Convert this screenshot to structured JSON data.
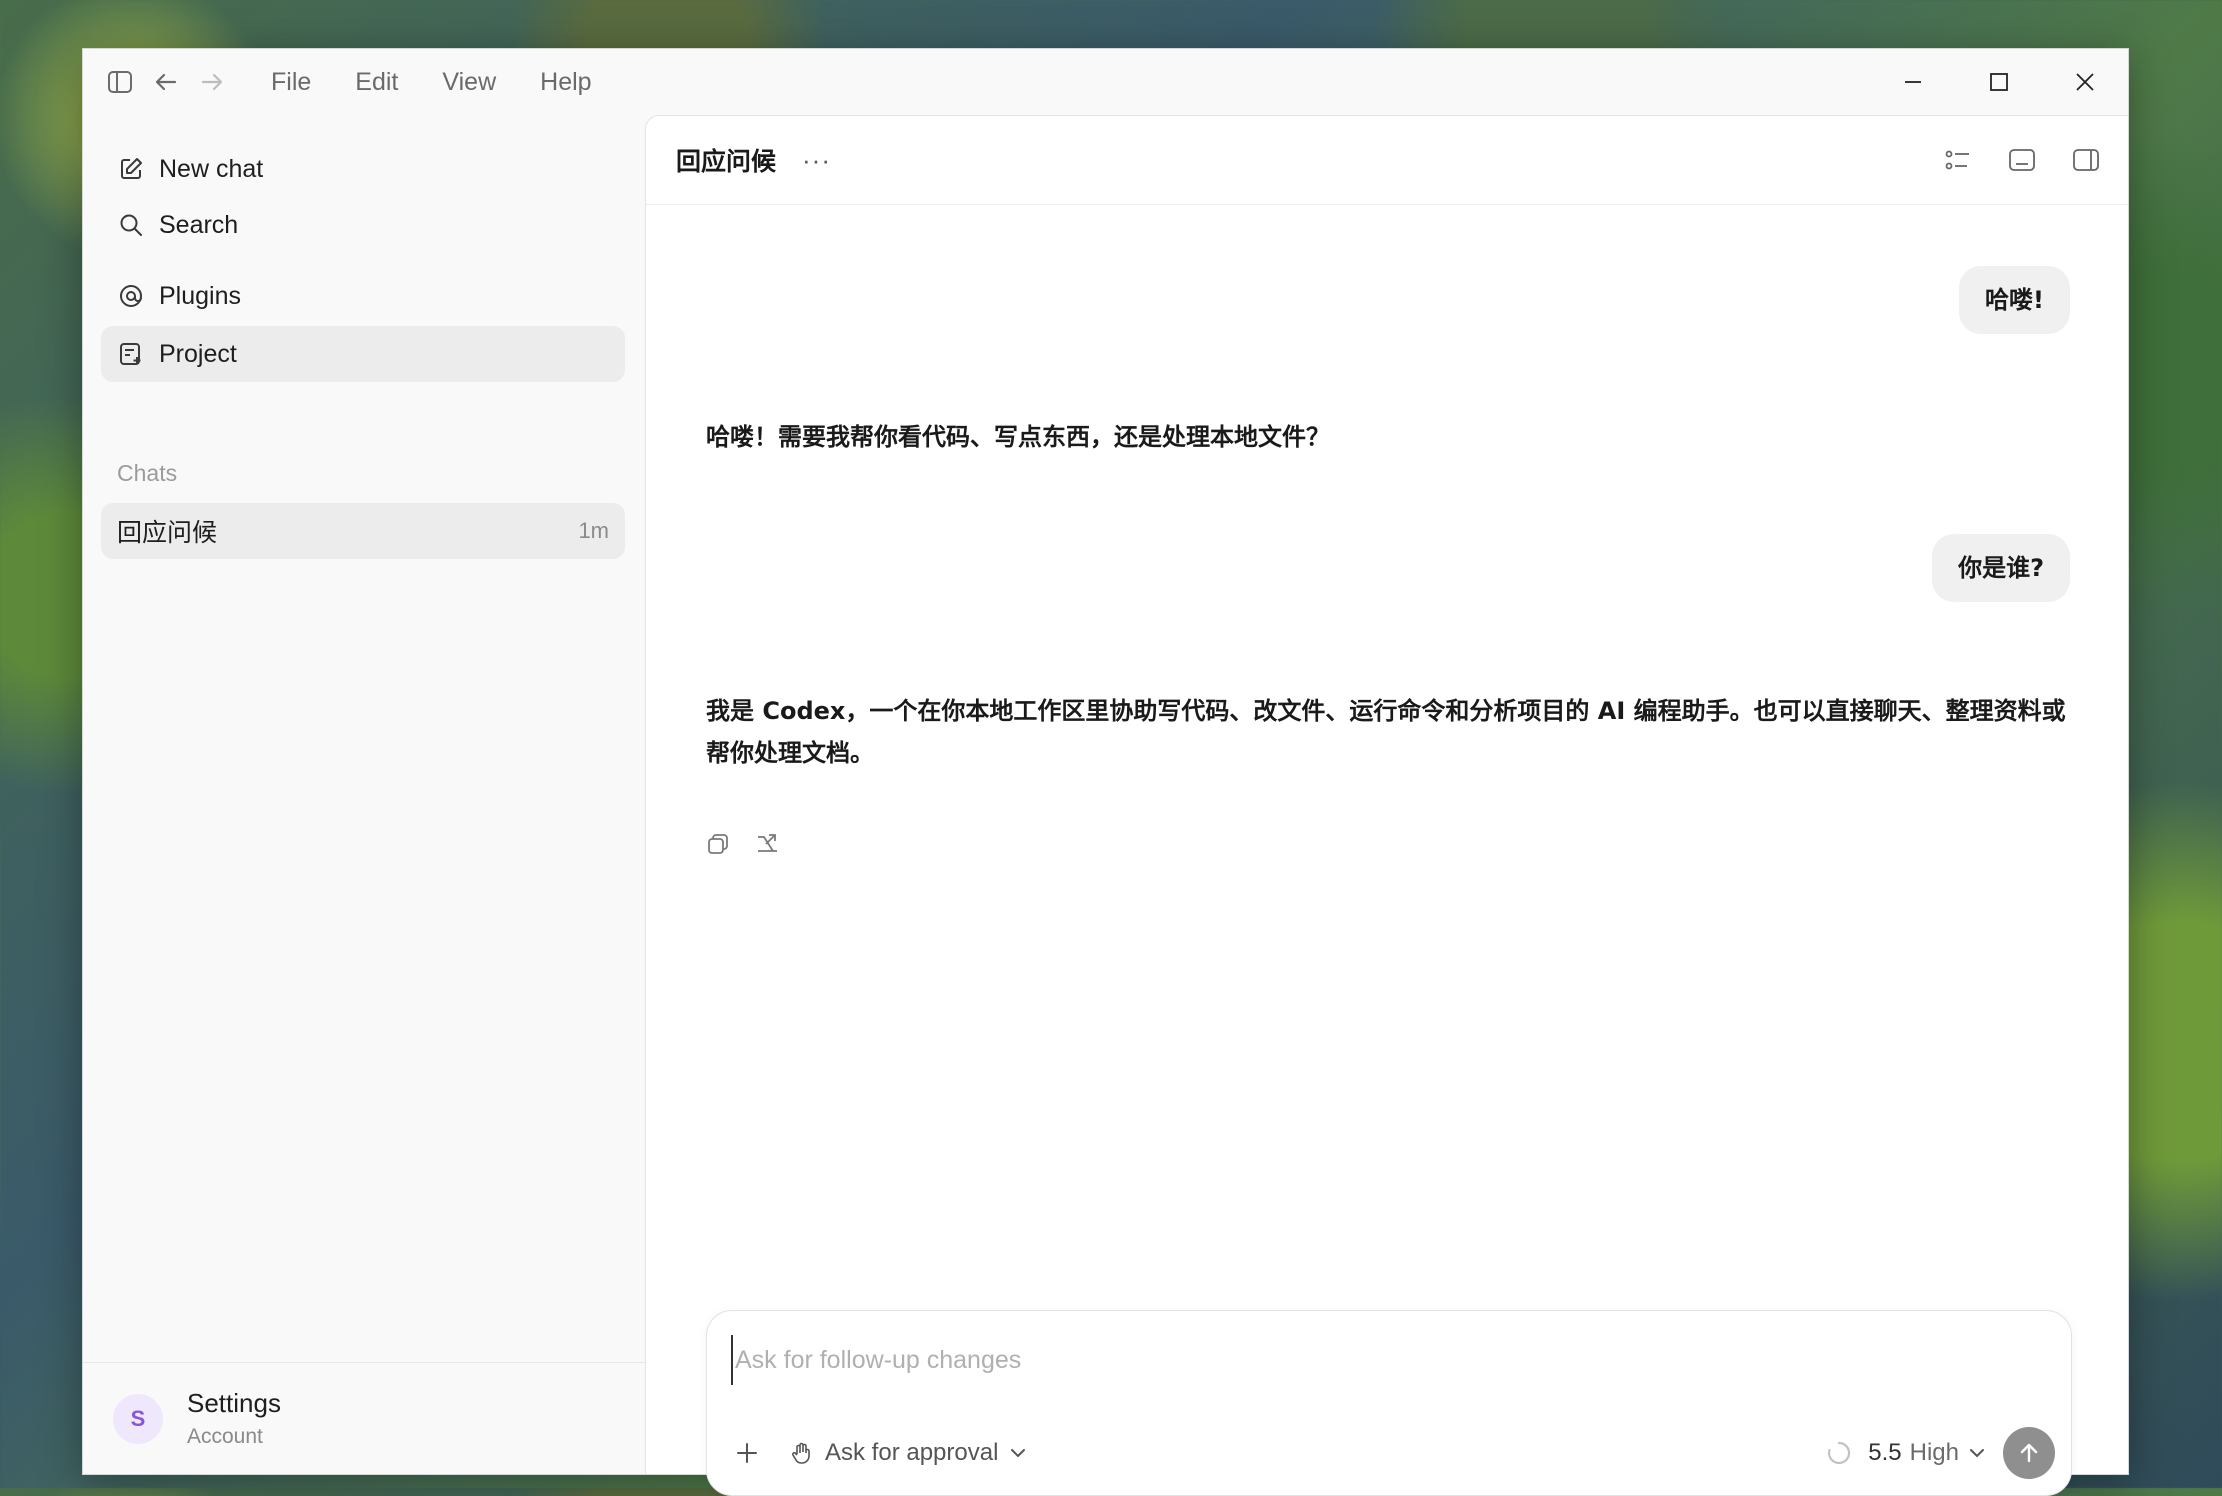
{
  "titlebar": {
    "menu": [
      "File",
      "Edit",
      "View",
      "Help"
    ]
  },
  "sidebar": {
    "nav": [
      {
        "label": "New chat",
        "icon": "edit-icon"
      },
      {
        "label": "Search",
        "icon": "search-icon"
      },
      {
        "label": "Plugins",
        "icon": "at-sign-icon"
      },
      {
        "label": "Project",
        "icon": "project-icon"
      }
    ],
    "chats_heading": "Chats",
    "chats": [
      {
        "title": "回应问候",
        "time": "1m"
      }
    ],
    "footer": {
      "avatar_letter": "S",
      "name": "Settings",
      "sub": "Account"
    }
  },
  "thread": {
    "title": "回应问候",
    "more": "···",
    "messages": [
      {
        "role": "user",
        "text": "哈喽!"
      },
      {
        "role": "assistant",
        "text": "哈喽！需要我帮你看代码、写点东西，还是处理本地文件？"
      },
      {
        "role": "user",
        "text": "你是谁?"
      },
      {
        "role": "assistant",
        "text": "我是 Codex，一个在你本地工作区里协助写代码、改文件、运行命令和分析项目的 AI 编程助手。也可以直接聊天、整理资料或帮你处理文档。"
      }
    ]
  },
  "composer": {
    "placeholder": "Ask for follow-up changes",
    "approval_label": "Ask for approval",
    "model_version": "5.5",
    "model_effort": "High"
  },
  "colors": {
    "accent_avatar": "#8a56d9",
    "send_button": "#8f8f8f"
  }
}
